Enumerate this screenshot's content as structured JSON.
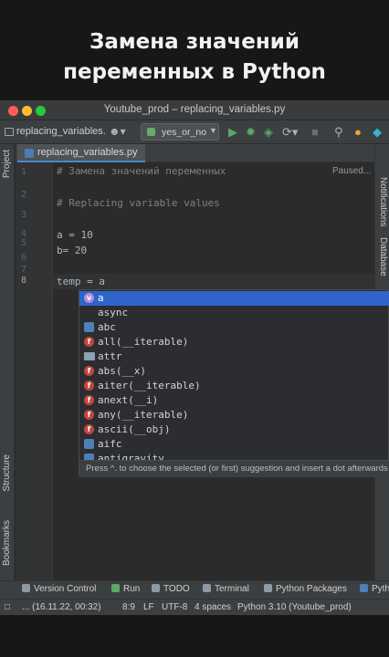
{
  "headline": {
    "line1": "Замена значений",
    "line2": "переменных в Python"
  },
  "window": {
    "title": "Youtube_prod – replacing_variables.py"
  },
  "toolbar": {
    "project_label": "replacing_variables.",
    "user_icon": "user-icon",
    "run_config": "yes_or_no",
    "icons": [
      "run-icon",
      "debug-icon",
      "coverage-icon",
      "profile-icon",
      "stop-icon",
      "search-icon",
      "update-icon",
      "jetbrains-icon"
    ]
  },
  "left_sidebar": {
    "top": [
      "Project"
    ],
    "bottom": [
      "Structure",
      "Bookmarks"
    ]
  },
  "right_sidebar": [
    "Notifications",
    "Database"
  ],
  "tab": {
    "label": "replacing_variables.py"
  },
  "editor": {
    "status": "Paused...",
    "lines": [
      {
        "num": "1",
        "text": "# Замена значений переменных",
        "comment": true
      },
      {
        "num": "2",
        "text": "",
        "comment": false
      },
      {
        "num": "3",
        "text": "# Replacing variable values",
        "comment": true
      },
      {
        "num": "4",
        "text": "",
        "comment": false
      },
      {
        "num": "5",
        "text": "a = 10",
        "comment": false
      },
      {
        "num": "6",
        "text": "b= 20",
        "comment": false
      },
      {
        "num": "7",
        "text": "",
        "comment": false
      },
      {
        "num": "8",
        "text": "temp = a",
        "comment": false,
        "current": true
      }
    ]
  },
  "completion": {
    "items": [
      {
        "icon": "variable-icon",
        "badge": "v",
        "label": "a",
        "selected": true
      },
      {
        "icon": "keyword",
        "badge": "",
        "label": "async",
        "selected": false
      },
      {
        "icon": "python-package-icon",
        "badge": "",
        "label": "abc",
        "selected": false
      },
      {
        "icon": "function-icon",
        "badge": "f",
        "label": "all(__iterable)",
        "selected": false
      },
      {
        "icon": "folder-icon",
        "badge": "",
        "label": "attr",
        "selected": false
      },
      {
        "icon": "function-icon",
        "badge": "f",
        "label": "abs(__x)",
        "selected": false
      },
      {
        "icon": "function-icon",
        "badge": "f",
        "label": "aiter(__iterable)",
        "selected": false
      },
      {
        "icon": "function-icon",
        "badge": "f",
        "label": "anext(__i)",
        "selected": false
      },
      {
        "icon": "function-icon",
        "badge": "f",
        "label": "any(__iterable)",
        "selected": false
      },
      {
        "icon": "function-icon",
        "badge": "f",
        "label": "ascii(__obj)",
        "selected": false
      },
      {
        "icon": "python-package-icon",
        "badge": "",
        "label": "aifc",
        "selected": false
      },
      {
        "icon": "python-package-icon",
        "badge": "",
        "label": "antigravity",
        "selected": false
      }
    ],
    "hint": "Press ^. to choose the selected (or first) suggestion and insert a dot afterwards"
  },
  "bottom_tools": [
    "Version Control",
    "Run",
    "TODO",
    "Terminal",
    "Python Packages",
    "Pyth"
  ],
  "statusbar": {
    "left": "... (16.11.22, 00:32)",
    "position": "8:9",
    "line_sep": "LF",
    "encoding": "UTF-8",
    "indent": "4 spaces",
    "interpreter": "Python 3.10 (Youtube_prod)"
  },
  "colors": {
    "selection": "#2f65ca",
    "comment": "#808080",
    "code": "#a9b7c6"
  }
}
